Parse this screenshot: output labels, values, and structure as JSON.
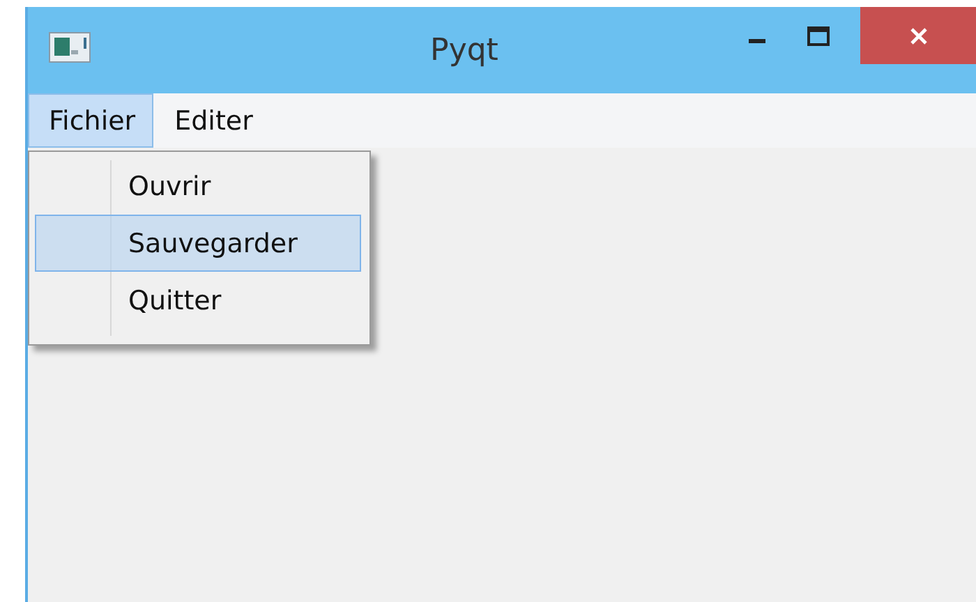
{
  "window": {
    "title": "Pyqt"
  },
  "menubar": [
    {
      "label": "Fichier",
      "selected": true
    },
    {
      "label": "Editer",
      "selected": false
    }
  ],
  "menu": [
    {
      "label": "Ouvrir",
      "selected": false
    },
    {
      "label": "Sauvegarder",
      "selected": true
    },
    {
      "label": "Quitter",
      "selected": false
    }
  ]
}
